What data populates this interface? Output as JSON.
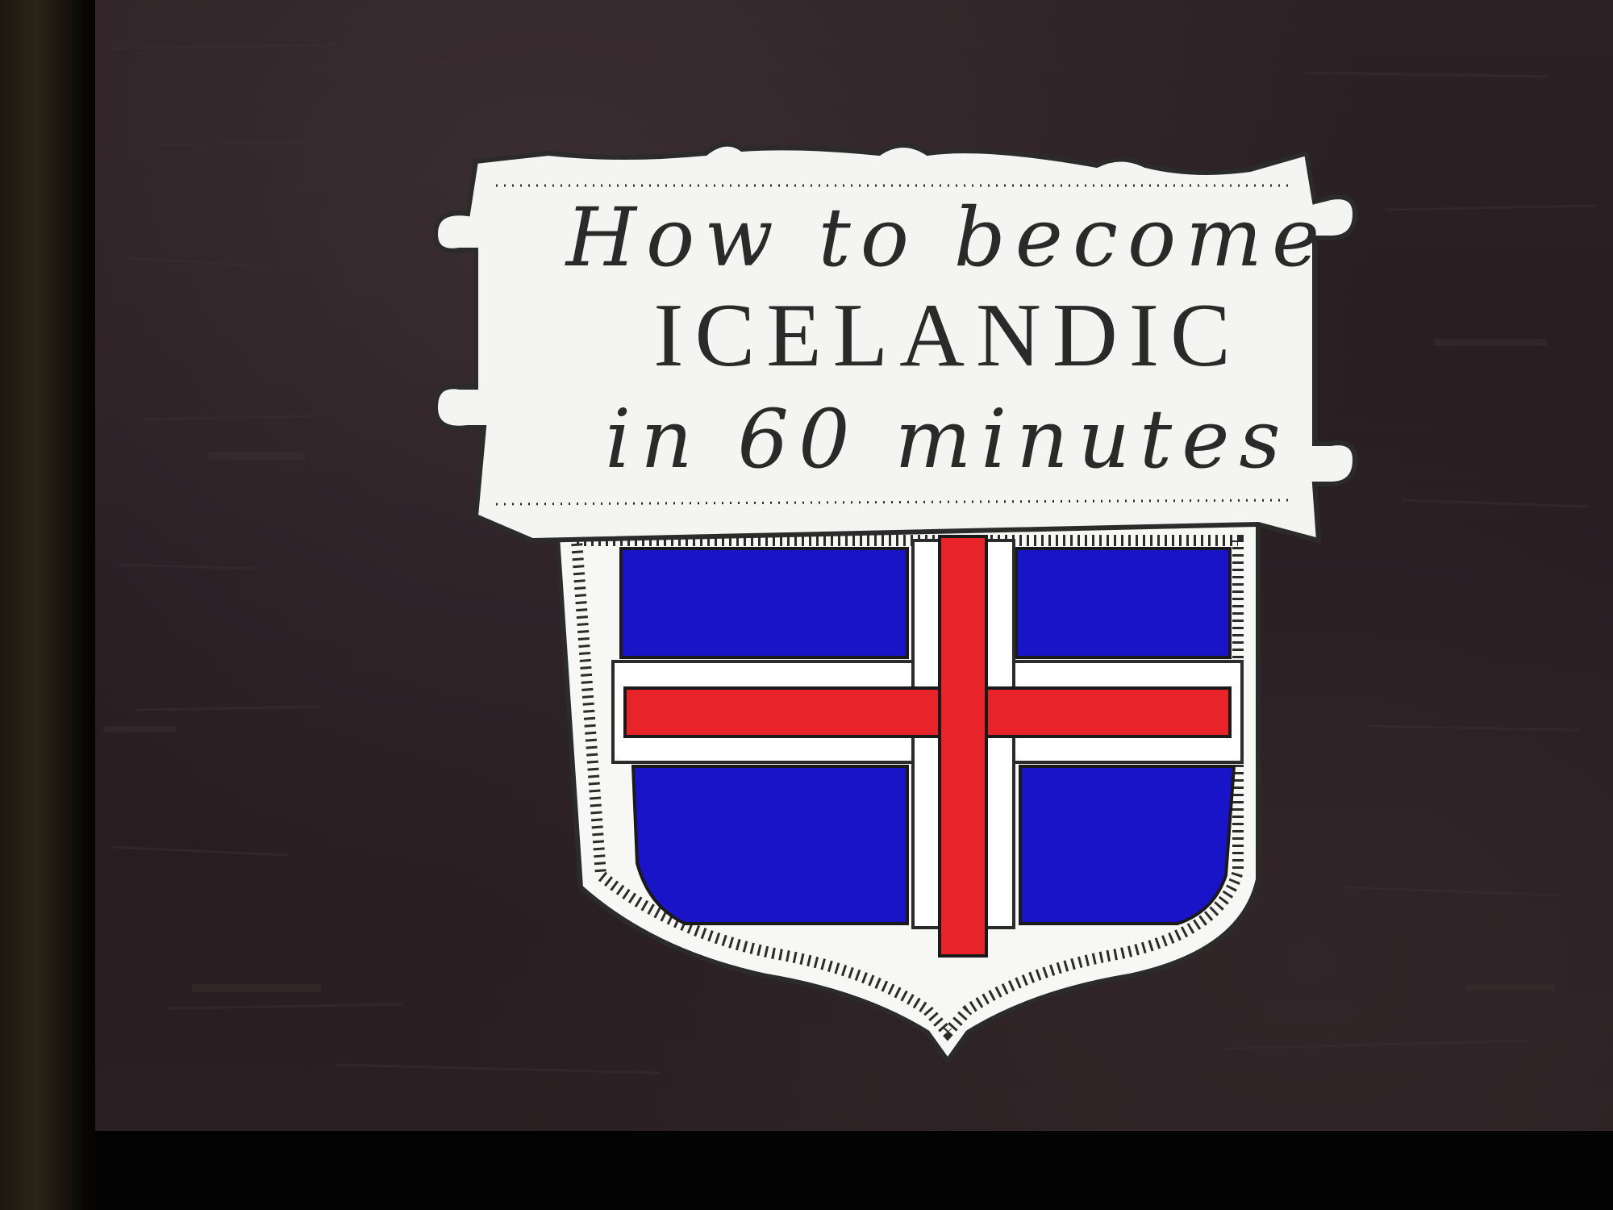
{
  "slide": {
    "title_line_1": "How to become",
    "title_line_2": "ICELANDIC",
    "title_line_3": "in 60 minutes"
  },
  "colors": {
    "background": "#281e21",
    "banner": "#f4f4f2",
    "flag_blue": "#1a14c8",
    "flag_white": "#ffffff",
    "flag_red": "#e8242a",
    "ink": "#2a2a2a"
  },
  "icons": {
    "emblem": "icelandic-flag-shield-icon"
  }
}
